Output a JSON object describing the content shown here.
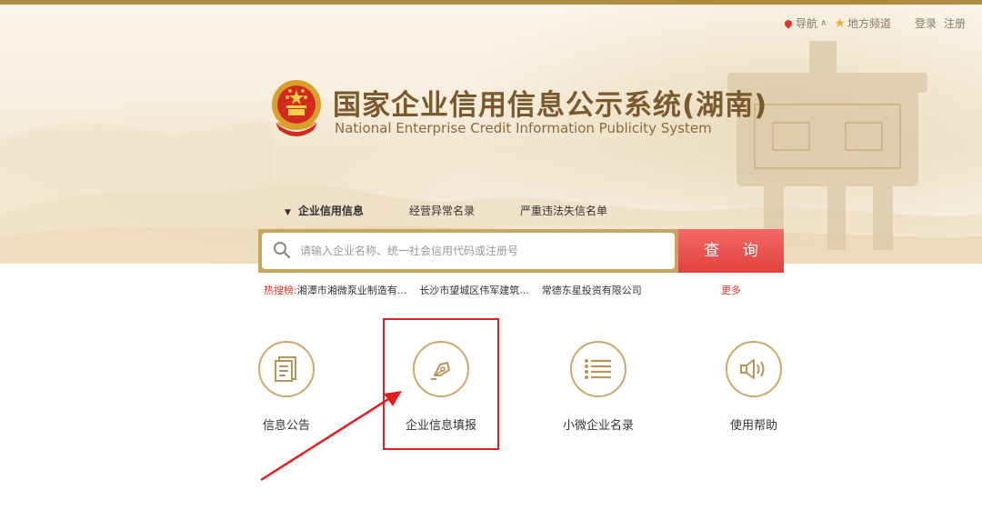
{
  "topnav": {
    "nav_label": "导航",
    "nav_caret": "∧",
    "local_label": "地方频道",
    "login": "登录",
    "register": "注册"
  },
  "header": {
    "title_cn": "国家企业信用信息公示系统(湖南)",
    "title_en": "National Enterprise Credit Information Publicity System"
  },
  "tabs": [
    {
      "label": "企业信用信息",
      "active": true
    },
    {
      "label": "经营异常名录",
      "active": false
    },
    {
      "label": "严重违法失信名单",
      "active": false
    }
  ],
  "search": {
    "placeholder": "请输入企业名称、统一社会信用代码或注册号",
    "button": "查 询"
  },
  "hot": {
    "label": "热搜榜:",
    "items": [
      "湘潭市湘微泵业制造有...",
      "长沙市望城区伟军建筑...",
      "常德东星投资有限公司"
    ],
    "more": "更多"
  },
  "functions": [
    {
      "label": "信息公告",
      "icon": "document-icon"
    },
    {
      "label": "企业信息填报",
      "icon": "pen-nib-icon"
    },
    {
      "label": "小微企业名录",
      "icon": "list-icon"
    },
    {
      "label": "使用帮助",
      "icon": "speaker-icon"
    }
  ],
  "colors": {
    "gold": "#c9a86c",
    "title_brown": "#7a5a2c",
    "search_red": "#e1403d",
    "highlight_red": "#e31e1e"
  }
}
